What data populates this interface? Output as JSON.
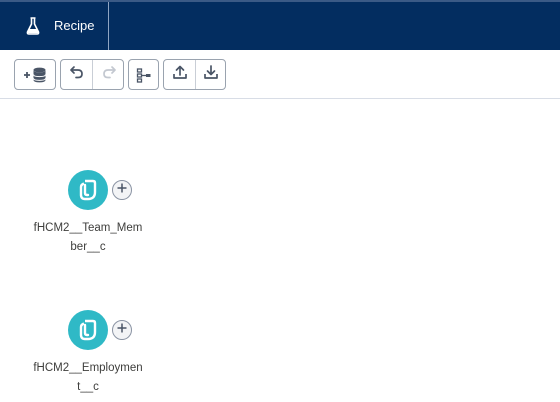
{
  "app": {
    "tab_label": "Recipe",
    "tab_icon": "flask-icon"
  },
  "toolbar": {
    "buttons": [
      {
        "name": "add-data-button",
        "icon": "add-database-icon"
      },
      {
        "name": "undo-button",
        "icon": "undo-icon"
      },
      {
        "name": "redo-button",
        "icon": "redo-icon",
        "disabled": true
      },
      {
        "name": "layout-button",
        "icon": "hierarchy-icon"
      },
      {
        "name": "upload-button",
        "icon": "upload-icon"
      },
      {
        "name": "download-button",
        "icon": "download-icon"
      }
    ]
  },
  "nodes": [
    {
      "label": "fHCM2__Team_Member__c",
      "label_lines": [
        "fHCM2__Team_Mem",
        "ber__c"
      ],
      "icon": "dataset-icon"
    },
    {
      "label": "fHCM2__Employment__c",
      "label_lines": [
        "fHCM2__Employmen",
        "t__c"
      ],
      "icon": "dataset-icon"
    }
  ],
  "colors": {
    "header_bg": "#032d60",
    "node_bg": "#2fb9c6",
    "text": "#3e3e3c"
  }
}
